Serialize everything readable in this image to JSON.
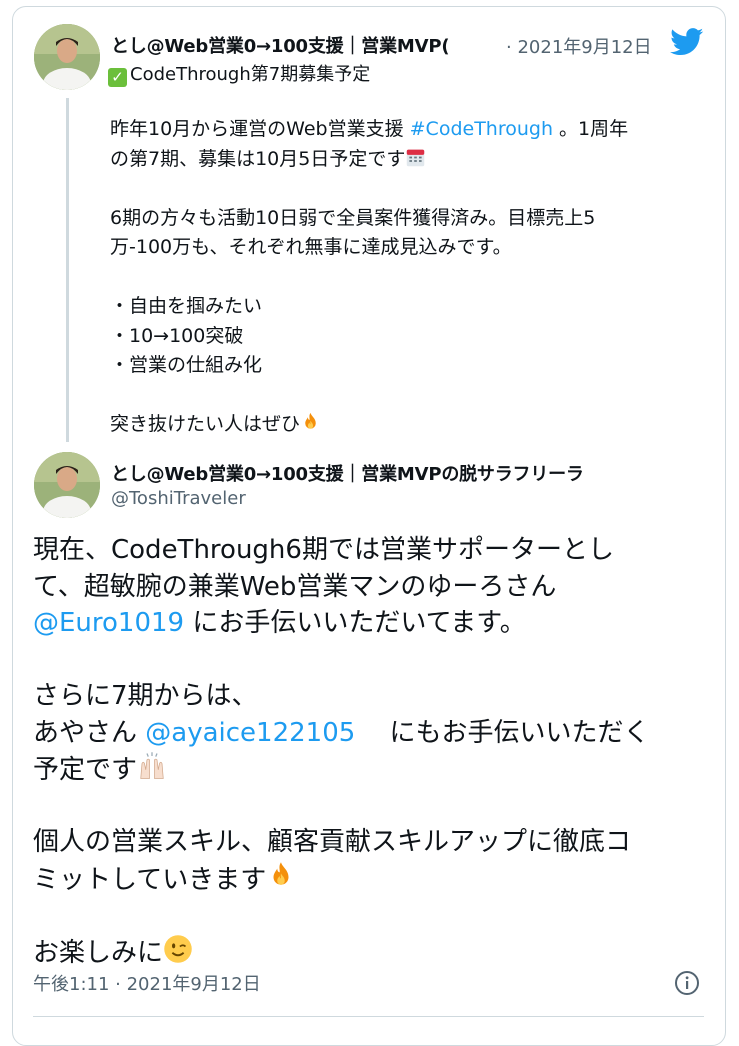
{
  "quoted": {
    "author_name": "とし@Web営業0→100支援｜営業MVP(",
    "separator": "·",
    "date": "2021年9月12日",
    "status": "CodeThrough第7期募集予定",
    "status_emoji": "check-mark-button",
    "lines": [
      {
        "parts": [
          {
            "t": "昨年10月から運営のWeb営業支援 "
          },
          {
            "t": "#CodeThrough",
            "link": true
          },
          {
            "t": " 。1周年"
          }
        ]
      },
      {
        "parts": [
          {
            "t": "の第7期、募集は10月5日予定です"
          }
        ],
        "emoji": "calendar-icon"
      },
      {
        "parts": [
          {
            "t": ""
          }
        ]
      },
      {
        "parts": [
          {
            "t": "6期の方々も活動10日弱で全員案件獲得済み。目標売上5"
          }
        ]
      },
      {
        "parts": [
          {
            "t": "万-100万も、それぞれ無事に達成見込みです。"
          }
        ]
      },
      {
        "parts": [
          {
            "t": ""
          }
        ]
      },
      {
        "parts": [
          {
            "t": "・自由を掴みたい"
          }
        ]
      },
      {
        "parts": [
          {
            "t": "・10→100突破"
          }
        ]
      },
      {
        "parts": [
          {
            "t": "・営業の仕組み化"
          }
        ]
      },
      {
        "parts": [
          {
            "t": ""
          }
        ]
      },
      {
        "parts": [
          {
            "t": "突き抜けたい人はぜひ"
          }
        ],
        "emoji": "fire-icon"
      }
    ]
  },
  "main": {
    "author_name": "とし@Web営業0→100支援｜営業MVPの脱サラフリーラ",
    "handle": "@ToshiTraveler",
    "lines": [
      {
        "parts": [
          {
            "t": "現在、CodeThrough6期では営業サポーターとし"
          }
        ]
      },
      {
        "parts": [
          {
            "t": "て、超敏腕の兼業Web営業マンのゆーろさん"
          }
        ]
      },
      {
        "parts": [
          {
            "t": "@Euro1019",
            "link": true
          },
          {
            "t": " にお手伝いいただいてます。"
          }
        ]
      },
      {
        "parts": [
          {
            "t": ""
          }
        ]
      },
      {
        "parts": [
          {
            "t": "さらに7期からは、"
          }
        ]
      },
      {
        "parts": [
          {
            "t": "あやさん "
          },
          {
            "t": "@ayaice122105",
            "link": true
          },
          {
            "t": " 　にもお手伝いいただく"
          }
        ]
      },
      {
        "parts": [
          {
            "t": "予定です"
          }
        ],
        "emoji": "raising-hands-icon"
      },
      {
        "parts": [
          {
            "t": ""
          }
        ]
      },
      {
        "parts": [
          {
            "t": "個人の営業スキル、顧客貢献スキルアップに徹底コ"
          }
        ]
      },
      {
        "parts": [
          {
            "t": "ミットしていきます"
          }
        ],
        "emoji": "fire-icon"
      },
      {
        "parts": [
          {
            "t": ""
          }
        ]
      },
      {
        "parts": [
          {
            "t": "お楽しみに"
          }
        ],
        "emoji": "winking-face-icon"
      }
    ],
    "timestamp": "午後1:11 · 2021年9月12日"
  },
  "icons": {
    "brand": "twitter-bird-icon",
    "info": "info-icon"
  },
  "colors": {
    "link": "#1d9bf0",
    "secondary_text": "#536471",
    "border": "#cfd9de",
    "brand": "#1d9bf0"
  }
}
